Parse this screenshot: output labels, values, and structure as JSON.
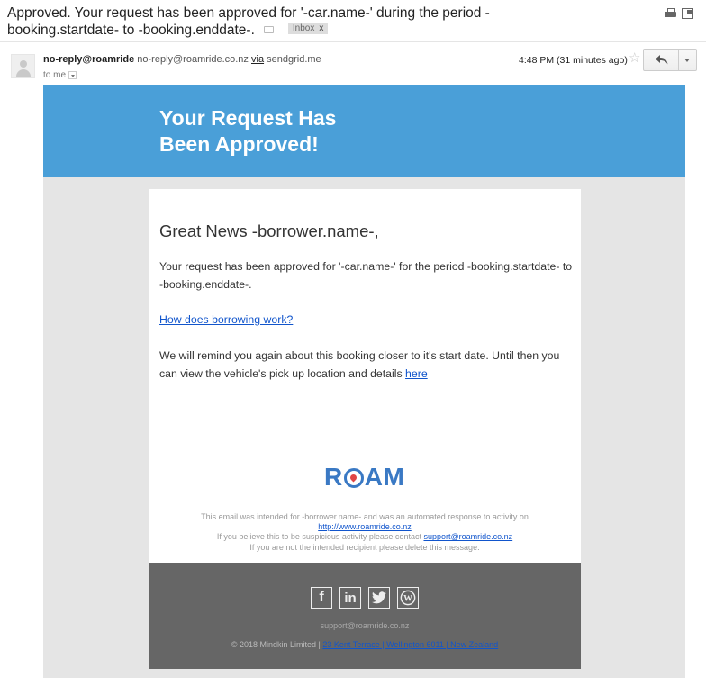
{
  "subject": {
    "text": "Approved. Your request has been approved for '-car.name-' during the period -booking.startdate- to -booking.enddate-.",
    "label": "Inbox",
    "label_close": "x"
  },
  "header": {
    "sender_name": "no-reply@roamride",
    "sender_email": "no-reply@roamride.co.nz",
    "via_label": "via",
    "via_domain": "sendgrid.me",
    "to": "to me",
    "time": "4:48 PM (31 minutes ago)",
    "star": "☆"
  },
  "email": {
    "banner_line1": "Your Request Has",
    "banner_line2": "Been Approved!",
    "greeting": "Great News -borrower.name-,",
    "paragraph1": "Your request has been approved for '-car.name-' for the period -booking.startdate- to -booking.enddate-.",
    "help_link": "How does borrowing work?",
    "paragraph3": "We will remind you again about this booking closer to it's start date. Until then you can view the vehicle's pick up location and details",
    "here_link": "here",
    "logo": {
      "left": "R",
      "right": "AM"
    },
    "disclaimer": {
      "line1": "This email was intended for -borrower.name- and was an automated response to activity on",
      "link1": "http://www.roamride.co.nz",
      "line3": "If you believe this to be suspicious activity please contact",
      "link2": "support@roamride.co.nz",
      "line4": "If you are not the intended recipient please delete this message."
    }
  },
  "footer": {
    "socials": [
      {
        "name": "facebook",
        "glyph": "f"
      },
      {
        "name": "linkedin",
        "glyph": "in"
      },
      {
        "name": "twitter",
        "glyph": "🐦"
      },
      {
        "name": "wordpress",
        "glyph": "W"
      }
    ],
    "email": "support@roamride.co.nz",
    "copyright": "© 2018 Mindkin Limited |",
    "address": "23 Kent Terrace | Wellington 6011 | New Zealand"
  },
  "colors": {
    "banner": "#4a9fd8",
    "footer": "#666666",
    "link": "#1155cc",
    "logo": "#3a79c4"
  }
}
